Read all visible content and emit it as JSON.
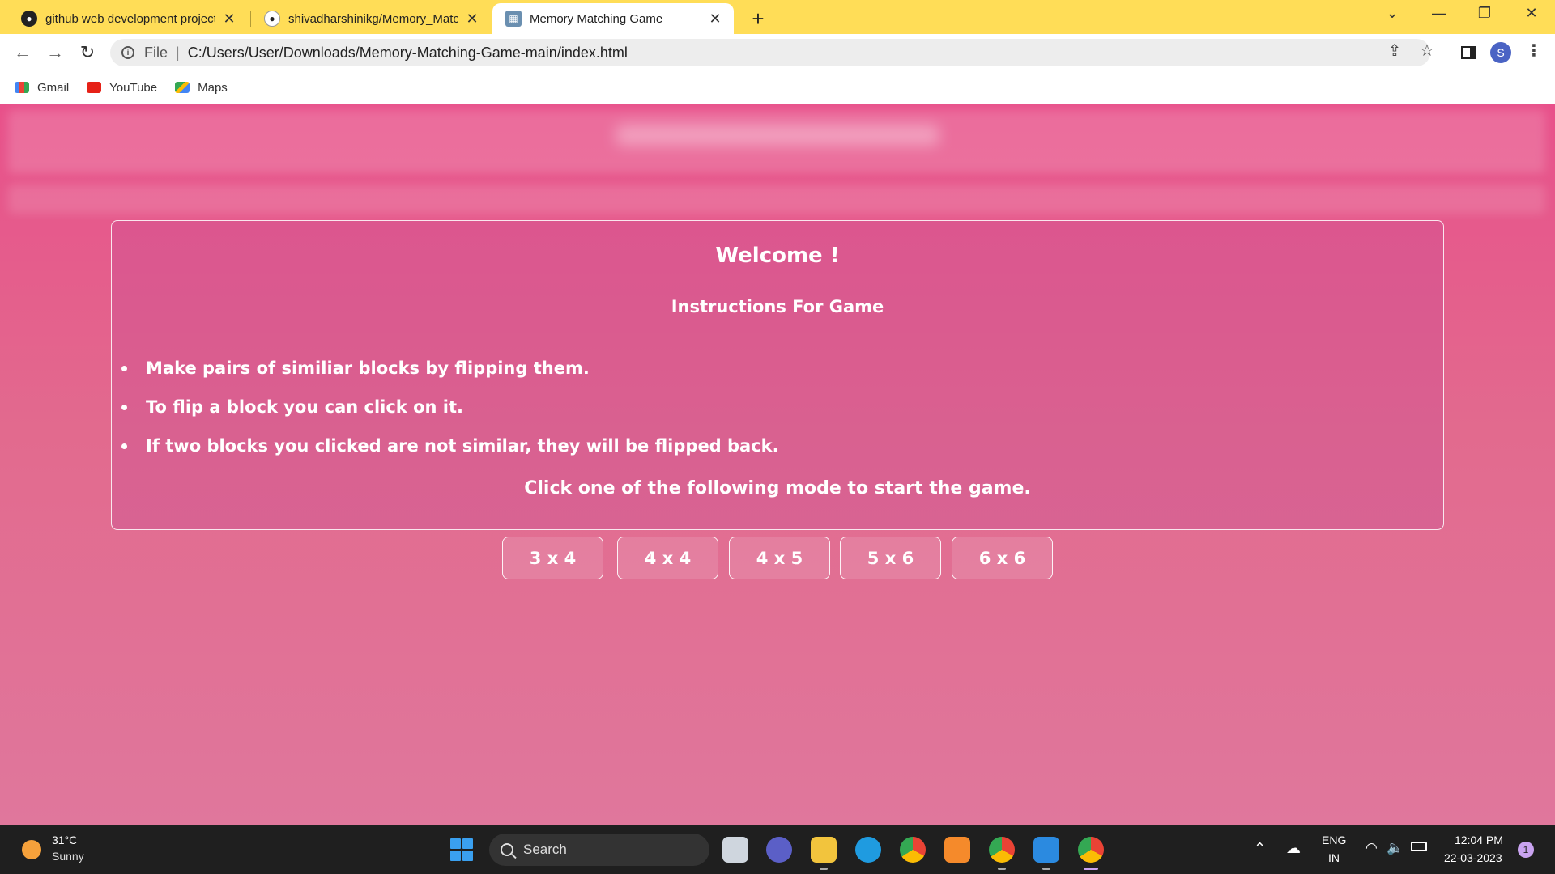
{
  "browser": {
    "tabs": [
      {
        "title": "github web development project",
        "favicon": "github-icon"
      },
      {
        "title": "shivadharshinikg/Memory_Match",
        "favicon": "github-icon"
      },
      {
        "title": "Memory Matching Game",
        "favicon": "game-grid-icon"
      }
    ],
    "close_glyph": "✕",
    "new_tab_glyph": "+",
    "url_scheme": "File",
    "url_separator": "|",
    "url": "C:/Users/User/Downloads/Memory-Matching-Game-main/index.html",
    "profile_initial": "S",
    "bookmarks": [
      {
        "label": "Gmail",
        "icon": "gmail-icon"
      },
      {
        "label": "YouTube",
        "icon": "youtube-icon"
      },
      {
        "label": "Maps",
        "icon": "maps-icon"
      }
    ]
  },
  "game": {
    "welcome": "Welcome !",
    "instructions_title": "Instructions For Game",
    "instructions": [
      "Make pairs of similiar blocks by flipping them.",
      "To flip a block you can click on it.",
      "If two blocks you clicked are not similar, they will be flipped back."
    ],
    "start_prompt": "Click one of the following mode to start the game.",
    "modes": [
      "3 x 4",
      "4 x 4",
      "4 x 5",
      "5 x 6",
      "6 x 6"
    ]
  },
  "taskbar": {
    "temperature": "31°C",
    "weather": "Sunny",
    "search_label": "Search",
    "lang_top": "ENG",
    "lang_bottom": "IN",
    "time": "12:04 PM",
    "date": "22-03-2023",
    "notification_count": "1"
  },
  "colors": {
    "tabstrip": "#ffdd57",
    "page_top": "#e8508a",
    "page_bottom": "#e0779c",
    "taskbar": "#1f1f1f"
  }
}
